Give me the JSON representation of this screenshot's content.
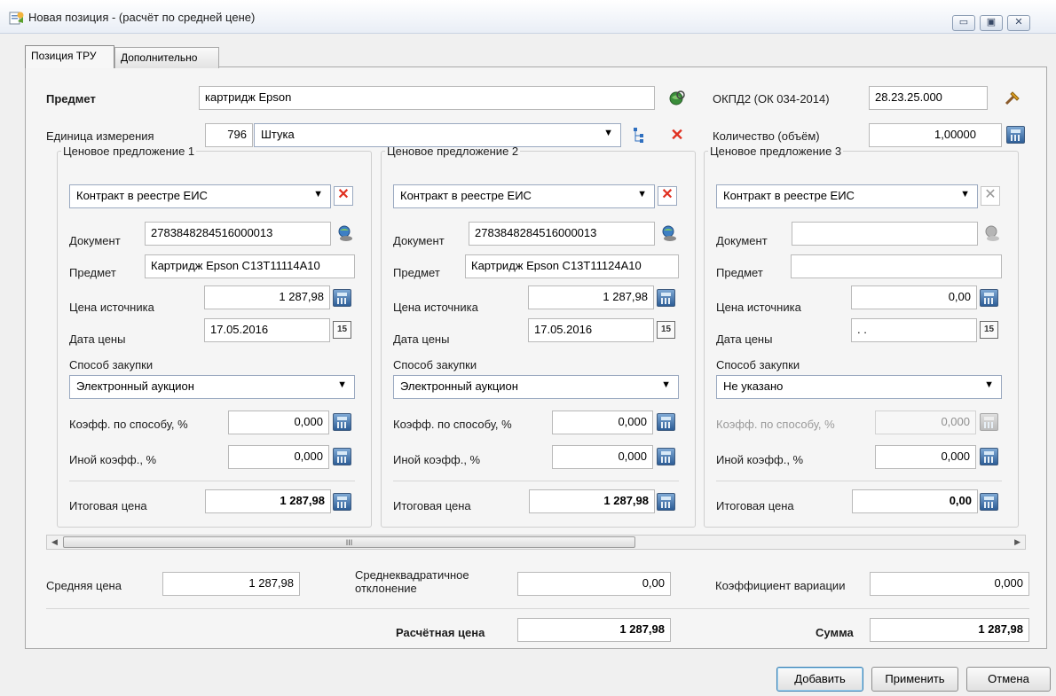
{
  "window": {
    "title": "Новая позиция - (расчёт по средней цене)",
    "controls": [
      "▭",
      "▣",
      "✕"
    ]
  },
  "tabs": [
    "Позиция ТРУ",
    "Дополнительно"
  ],
  "main": {
    "subject_label": "Предмет",
    "subject_value": "картридж Epson",
    "okpd_label": "ОКПД2 (ОК 034-2014)",
    "okpd_value": "28.23.25.000",
    "unit_label": "Единица измерения",
    "unit_code": "796",
    "unit_name": "Штука",
    "qty_label": "Количество (объём)",
    "qty_value": "1,00000"
  },
  "offers": [
    {
      "legend": "Ценовое предложение 1",
      "source": "Контракт в реестре ЕИС",
      "doc_label": "Документ",
      "doc_value": "2783848284516000013",
      "subject_label": "Предмет",
      "subject_value": "Картридж Epson C13T11114A10",
      "price_label": "Цена источника",
      "price_value": "1 287,98",
      "date_label": "Дата цены",
      "date_value": "17.05.2016",
      "method_label": "Способ закупки",
      "method_value": "Электронный аукцион",
      "coef_label": "Коэфф. по способу, %",
      "coef_value": "0,000",
      "other_label": "Иной коэфф., %",
      "other_value": "0,000",
      "total_label": "Итоговая цена",
      "total_value": "1 287,98"
    },
    {
      "legend": "Ценовое предложение 2",
      "source": "Контракт в реестре ЕИС",
      "doc_label": "Документ",
      "doc_value": "2783848284516000013",
      "subject_label": "Предмет",
      "subject_value": "Картридж Epson C13T11124A10",
      "price_label": "Цена источника",
      "price_value": "1 287,98",
      "date_label": "Дата цены",
      "date_value": "17.05.2016",
      "method_label": "Способ закупки",
      "method_value": "Электронный аукцион",
      "coef_label": "Коэфф. по способу, %",
      "coef_value": "0,000",
      "other_label": "Иной коэфф., %",
      "other_value": "0,000",
      "total_label": "Итоговая цена",
      "total_value": "1 287,98"
    },
    {
      "legend": "Ценовое предложение 3",
      "source": "Контракт в реестре ЕИС",
      "doc_label": "Документ",
      "doc_value": "",
      "subject_label": "Предмет",
      "subject_value": "",
      "price_label": "Цена источника",
      "price_value": "0,00",
      "date_label": "Дата цены",
      "date_value": ". .",
      "method_label": "Способ закупки",
      "method_value": "Не указано",
      "coef_label": "Коэфф. по способу, %",
      "coef_value": "0,000",
      "other_label": "Иной коэфф., %",
      "other_value": "0,000",
      "total_label": "Итоговая цена",
      "total_value": "0,00"
    }
  ],
  "calendar_glyph": "15",
  "scroll_grip": "III",
  "stats": {
    "avg_label": "Средняя цена",
    "avg_value": "1 287,98",
    "stddev_label_1": "Среднеквадратичное",
    "stddev_label_2": "отклонение",
    "stddev_value": "0,00",
    "variation_label": "Коэффициент вариации",
    "variation_value": "0,000",
    "calc_price_label": "Расчётная цена",
    "calc_price_value": "1 287,98",
    "sum_label": "Сумма",
    "sum_value": "1 287,98"
  },
  "buttons": {
    "add": "Добавить",
    "apply": "Применить",
    "cancel": "Отмена"
  },
  "colors": {
    "accent_blue": "#2d5d96",
    "delete_red": "#e03020",
    "window_bg": "#f0f0f0"
  }
}
